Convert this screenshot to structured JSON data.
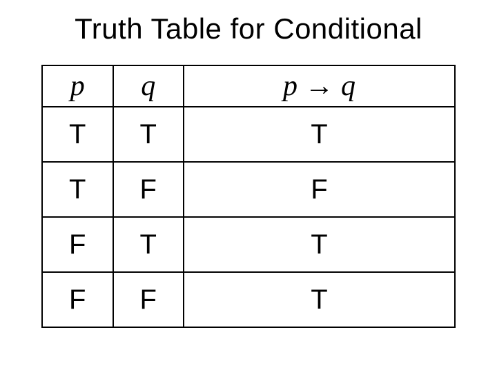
{
  "title": "Truth Table for Conditional",
  "chart_data": {
    "type": "table",
    "columns": [
      "p",
      "q",
      "p → q"
    ],
    "rows": [
      [
        "T",
        "T",
        "T"
      ],
      [
        "T",
        "F",
        "F"
      ],
      [
        "F",
        "T",
        "T"
      ],
      [
        "F",
        "F",
        "T"
      ]
    ]
  }
}
